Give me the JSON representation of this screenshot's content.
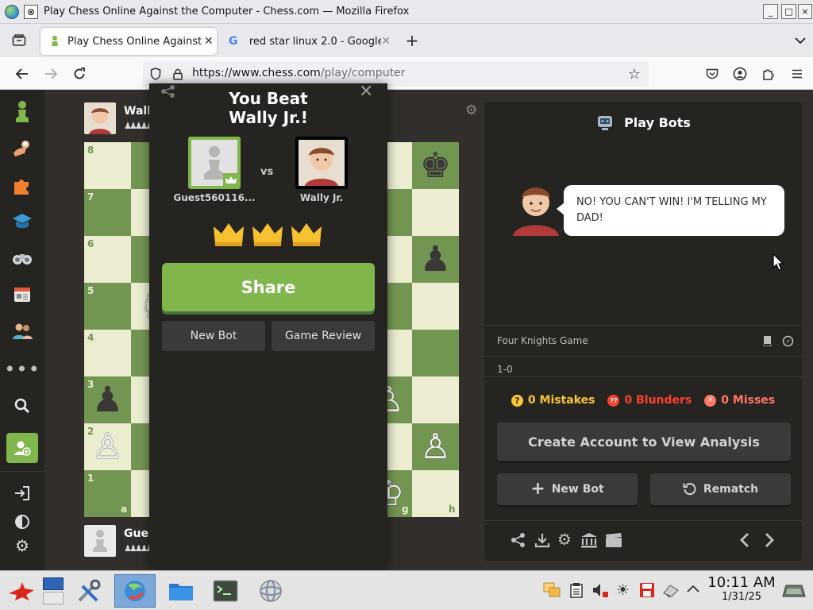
{
  "window": {
    "title": "Play Chess Online Against the Computer - Chess.com — Mozilla Firefox",
    "controls": [
      "_",
      "□",
      "×"
    ]
  },
  "tabs": [
    {
      "label": "Play Chess Online Against",
      "active": true
    },
    {
      "label": "red star linux 2.0 - Google",
      "active": false
    }
  ],
  "address_bar": {
    "url_host": "https://www.chess.com",
    "url_path": "/play/computer"
  },
  "board": {
    "ranks": [
      "8",
      "7",
      "6",
      "5",
      "4",
      "3",
      "2",
      "1"
    ],
    "files_shown": [
      "a",
      "g",
      "h"
    ]
  },
  "players": {
    "top": {
      "name": "Wally Jr."
    },
    "bottom": {
      "name": "Guest560116..."
    }
  },
  "modal": {
    "title_line1": "You Beat",
    "title_line2": "Wally Jr.!",
    "player_left": "Guest560116...",
    "vs": "vs",
    "player_right": "Wally Jr.",
    "crowns": 3,
    "share_label": "Share",
    "new_bot_label": "New Bot",
    "game_review_label": "Game Review"
  },
  "panel": {
    "header": "Play Bots",
    "bot_message": "NO! YOU CAN'T WIN! I'M TELLING MY DAD!",
    "opening": "Four Knights Game",
    "result": "1-0",
    "stats": {
      "mistakes": "0 Mistakes",
      "blunders": "0 Blunders",
      "misses": "0 Misses"
    },
    "create_account": "Create Account to View Analysis",
    "new_bot": "New Bot",
    "rematch": "Rematch"
  },
  "taskbar": {
    "time": "10:11 AM",
    "date": "1/31/25"
  },
  "colors": {
    "board_light": "#ebecd0",
    "board_dark": "#739552",
    "accent_green": "#81b64c",
    "mistake": "#f7c631",
    "blunder": "#fa412d",
    "miss": "#ff7769"
  }
}
